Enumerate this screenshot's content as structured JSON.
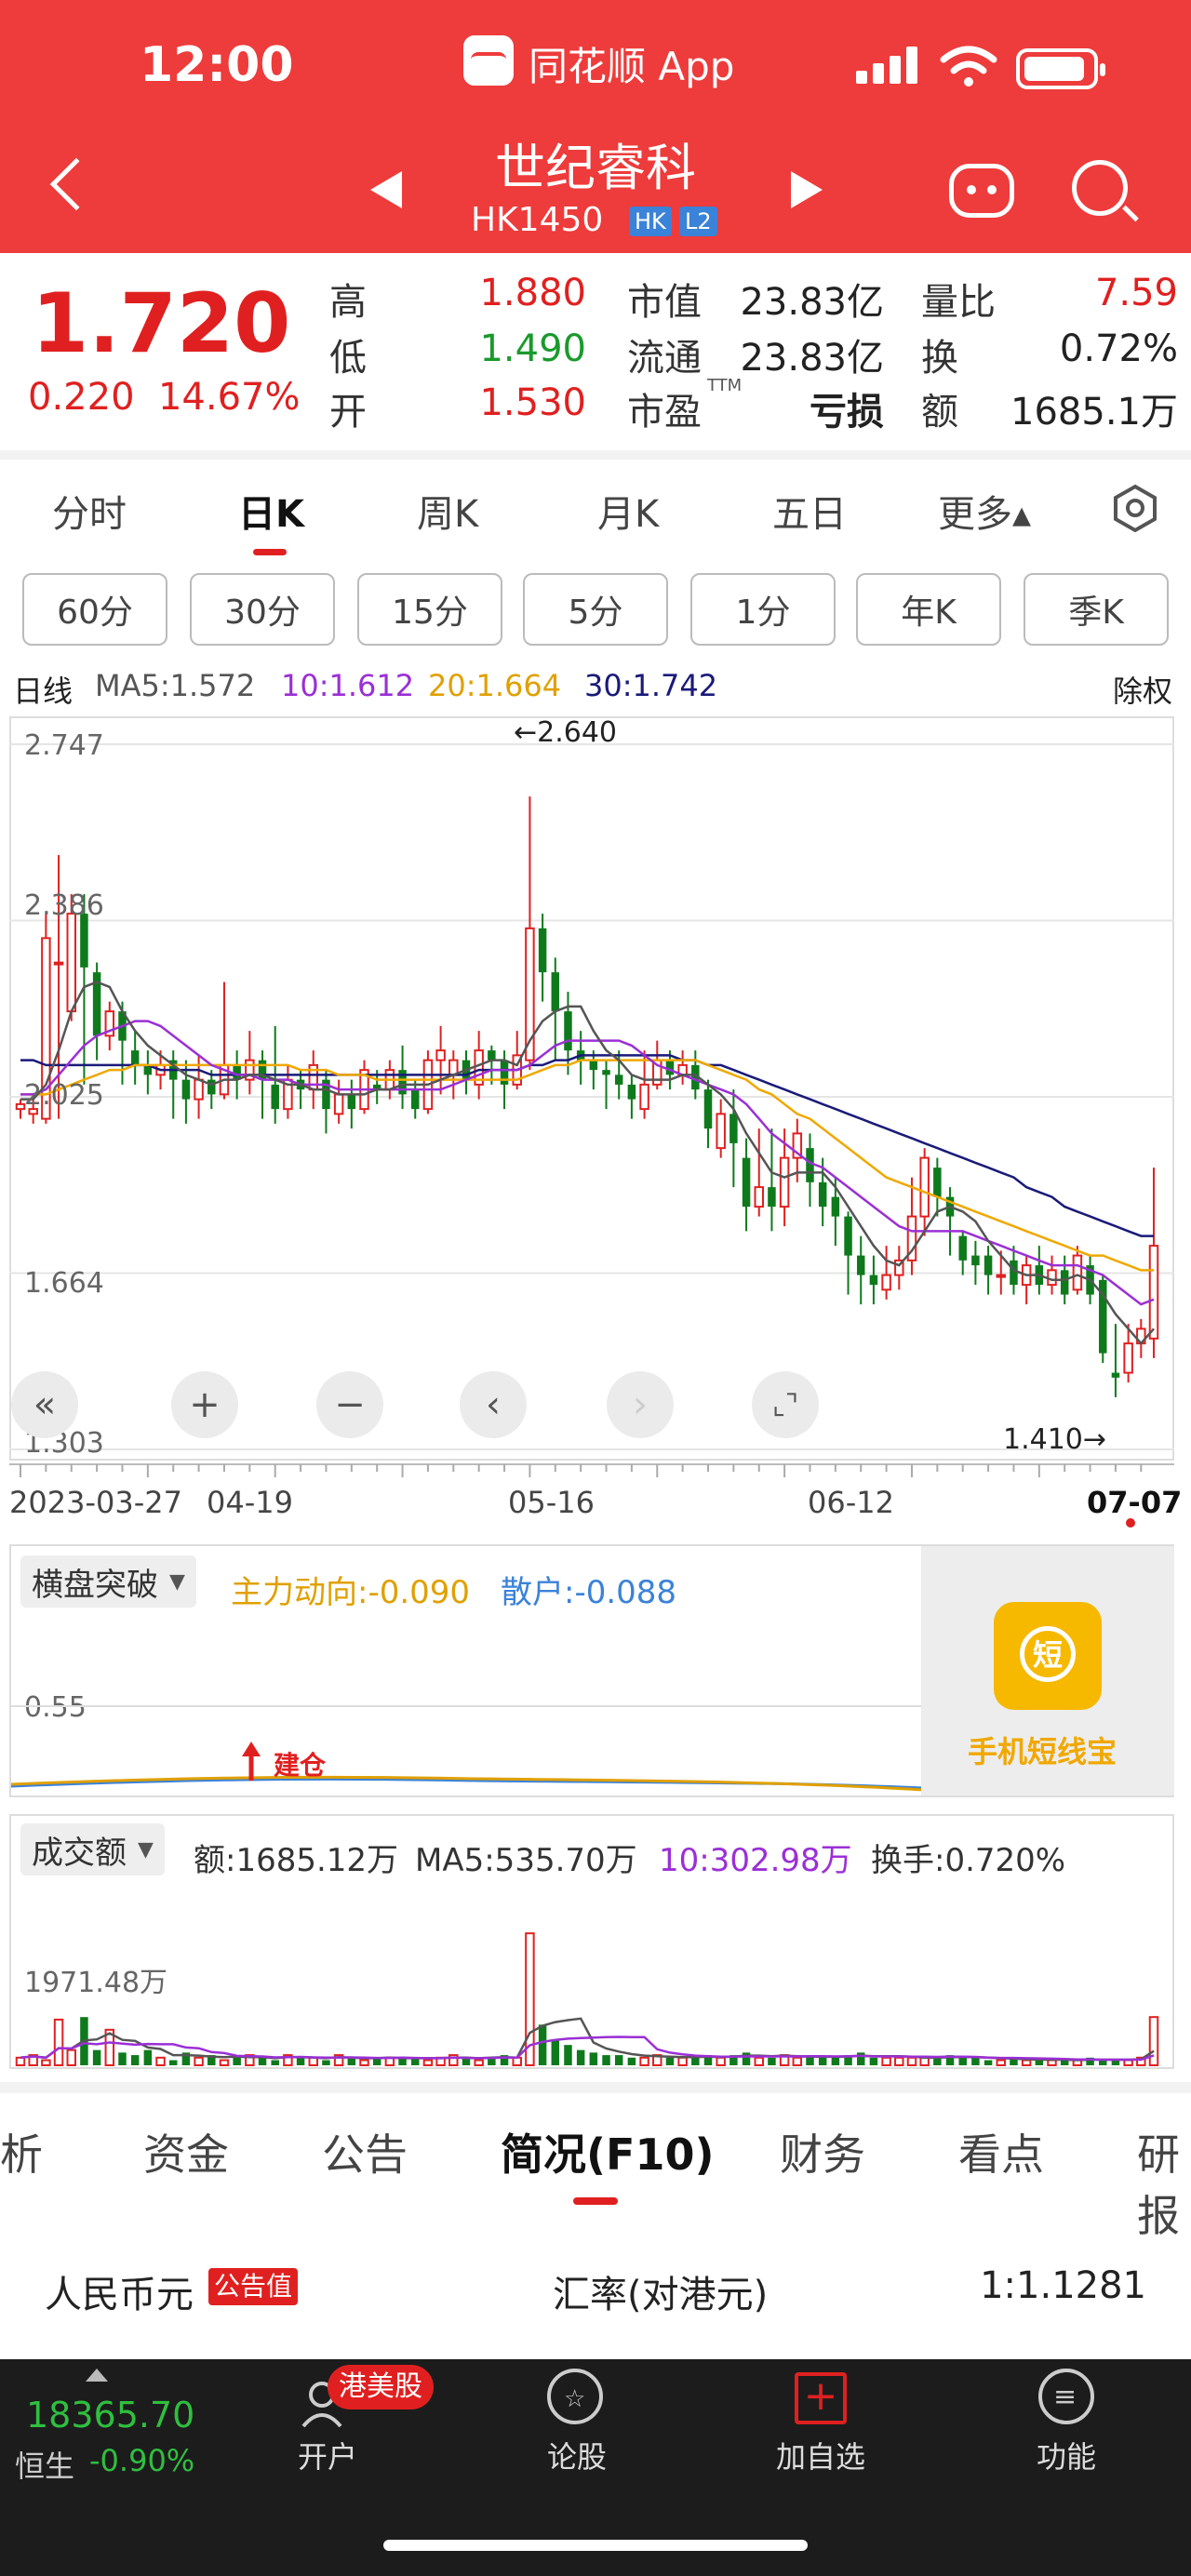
{
  "status": {
    "time": "12:00",
    "app_name": "同花顺 App"
  },
  "header": {
    "stock_name": "世纪睿科",
    "stock_code": "HK1450",
    "tags": [
      "HK",
      "L2"
    ]
  },
  "quote": {
    "price": "1.720",
    "change": "0.220",
    "change_pct": "14.67%",
    "rows": [
      {
        "l1": "高",
        "v1": "1.880",
        "c1": "red",
        "l2": "市值",
        "v2": "23.83亿",
        "l3": "量比",
        "v3": "7.59",
        "c3": "red"
      },
      {
        "l1": "低",
        "v1": "1.490",
        "c1": "green",
        "l2": "流通",
        "v2": "23.83亿",
        "l3": "换",
        "v3": "0.72%",
        "c3": "dark"
      },
      {
        "l1": "开",
        "v1": "1.530",
        "c1": "red",
        "l2": "市盈",
        "sup": "TTM",
        "v2": "亏损",
        "l3": "额",
        "v3": "1685.1万",
        "c3": "dark"
      }
    ]
  },
  "period_tabs": [
    "分时",
    "日K",
    "周K",
    "月K",
    "五日",
    "更多▴"
  ],
  "minute_buttons": [
    "60分",
    "30分",
    "15分",
    "5分",
    "1分",
    "年K",
    "季K"
  ],
  "ma_legend": {
    "label": "日线",
    "ma5": "MA5:1.572",
    "ma10": "10:1.612",
    "ma20": "20:1.664",
    "ma30": "30:1.742",
    "adjust": "除权"
  },
  "colors": {
    "up": "#e02020",
    "down": "#0e7a1c",
    "ma5": "#555555",
    "ma10": "#9b2fd6",
    "ma20": "#f0a800",
    "ma30": "#1a1a7a"
  },
  "chart_data": {
    "type": "candlestick",
    "y_ticks": [
      "2.747",
      "2.386",
      "2.025",
      "1.664",
      "1.303"
    ],
    "high_marker": "←2.640",
    "low_marker": "1.410→",
    "x_labels": [
      "2023-03-27",
      "04-19",
      "05-16",
      "06-12",
      "07-07"
    ],
    "candles": [
      [
        2.0,
        2.01,
        1.98,
        2.02
      ],
      [
        1.99,
        2.0,
        1.97,
        2.03
      ],
      [
        1.98,
        2.35,
        1.97,
        2.4
      ],
      [
        2.3,
        2.3,
        1.98,
        2.52
      ],
      [
        2.2,
        2.4,
        2.18,
        2.44
      ],
      [
        2.4,
        2.29,
        2.05,
        2.44
      ],
      [
        2.28,
        2.15,
        2.1,
        2.3
      ],
      [
        2.15,
        2.2,
        2.12,
        2.22
      ],
      [
        2.2,
        2.14,
        2.05,
        2.22
      ],
      [
        2.12,
        2.09,
        2.05,
        2.16
      ],
      [
        2.09,
        2.07,
        2.03,
        2.12
      ],
      [
        2.07,
        2.09,
        2.04,
        2.12
      ],
      [
        2.1,
        2.06,
        1.98,
        2.12
      ],
      [
        2.06,
        2.02,
        1.97,
        2.1
      ],
      [
        2.02,
        2.06,
        1.98,
        2.11
      ],
      [
        2.06,
        2.03,
        2.0,
        2.08
      ],
      [
        2.03,
        2.09,
        2.02,
        2.26
      ],
      [
        2.09,
        2.06,
        2.02,
        2.12
      ],
      [
        2.06,
        2.1,
        2.03,
        2.16
      ],
      [
        2.1,
        2.06,
        1.98,
        2.12
      ],
      [
        2.05,
        2.0,
        1.97,
        2.17
      ],
      [
        2.0,
        2.06,
        1.98,
        2.09
      ],
      [
        2.06,
        2.04,
        2.0,
        2.08
      ],
      [
        2.04,
        2.09,
        2.0,
        2.12
      ],
      [
        2.06,
        2.0,
        1.95,
        2.08
      ],
      [
        1.99,
        2.03,
        1.97,
        2.06
      ],
      [
        2.03,
        2.0,
        1.96,
        2.06
      ],
      [
        2.0,
        2.08,
        1.99,
        2.1
      ],
      [
        2.05,
        2.04,
        2.01,
        2.08
      ],
      [
        2.04,
        2.08,
        2.02,
        2.1
      ],
      [
        2.08,
        2.03,
        2.0,
        2.13
      ],
      [
        2.04,
        2.0,
        1.98,
        2.06
      ],
      [
        2.0,
        2.1,
        1.99,
        2.12
      ],
      [
        2.1,
        2.12,
        2.03,
        2.17
      ],
      [
        2.07,
        2.1,
        2.02,
        2.12
      ],
      [
        2.1,
        2.06,
        2.03,
        2.12
      ],
      [
        2.05,
        2.12,
        2.02,
        2.16
      ],
      [
        2.12,
        2.1,
        2.05,
        2.13
      ],
      [
        2.1,
        2.05,
        2.0,
        2.12
      ],
      [
        2.05,
        2.11,
        2.04,
        2.16
      ],
      [
        2.1,
        2.37,
        2.08,
        2.64
      ],
      [
        2.37,
        2.28,
        2.22,
        2.4
      ],
      [
        2.28,
        2.2,
        2.1,
        2.31
      ],
      [
        2.2,
        2.12,
        2.07,
        2.24
      ],
      [
        2.12,
        2.1,
        2.05,
        2.16
      ],
      [
        2.1,
        2.08,
        2.04,
        2.12
      ],
      [
        2.08,
        2.07,
        2.0,
        2.1
      ],
      [
        2.07,
        2.05,
        2.02,
        2.12
      ],
      [
        2.05,
        2.02,
        1.98,
        2.07
      ],
      [
        2.0,
        2.05,
        1.98,
        2.12
      ],
      [
        2.05,
        2.1,
        2.04,
        2.14
      ],
      [
        2.1,
        2.07,
        2.04,
        2.12
      ],
      [
        2.07,
        2.09,
        2.05,
        2.12
      ],
      [
        2.09,
        2.04,
        2.02,
        2.12
      ],
      [
        2.04,
        1.96,
        1.92,
        2.06
      ],
      [
        1.92,
        1.99,
        1.9,
        2.02
      ],
      [
        1.99,
        1.93,
        1.84,
        2.04
      ],
      [
        1.9,
        1.8,
        1.75,
        1.94
      ],
      [
        1.8,
        1.84,
        1.78,
        1.96
      ],
      [
        1.84,
        1.8,
        1.75,
        1.96
      ],
      [
        1.8,
        1.9,
        1.76,
        1.96
      ],
      [
        1.9,
        1.95,
        1.85,
        1.98
      ],
      [
        1.92,
        1.85,
        1.8,
        1.95
      ],
      [
        1.85,
        1.8,
        1.76,
        1.9
      ],
      [
        1.82,
        1.78,
        1.72,
        1.86
      ],
      [
        1.78,
        1.7,
        1.62,
        1.79
      ],
      [
        1.7,
        1.66,
        1.6,
        1.74
      ],
      [
        1.66,
        1.64,
        1.6,
        1.7
      ],
      [
        1.63,
        1.66,
        1.61,
        1.72
      ],
      [
        1.66,
        1.69,
        1.63,
        1.72
      ],
      [
        1.69,
        1.78,
        1.66,
        1.86
      ],
      [
        1.78,
        1.9,
        1.74,
        1.92
      ],
      [
        1.88,
        1.82,
        1.78,
        1.9
      ],
      [
        1.82,
        1.78,
        1.7,
        1.84
      ],
      [
        1.74,
        1.69,
        1.66,
        1.75
      ],
      [
        1.7,
        1.68,
        1.64,
        1.73
      ],
      [
        1.7,
        1.66,
        1.62,
        1.72
      ],
      [
        1.66,
        1.66,
        1.62,
        1.71
      ],
      [
        1.69,
        1.64,
        1.62,
        1.72
      ],
      [
        1.64,
        1.68,
        1.6,
        1.7
      ],
      [
        1.68,
        1.64,
        1.62,
        1.72
      ],
      [
        1.64,
        1.67,
        1.62,
        1.7
      ],
      [
        1.67,
        1.62,
        1.6,
        1.7
      ],
      [
        1.63,
        1.7,
        1.62,
        1.72
      ],
      [
        1.68,
        1.62,
        1.6,
        1.7
      ],
      [
        1.65,
        1.5,
        1.48,
        1.66
      ],
      [
        1.46,
        1.45,
        1.41,
        1.56
      ],
      [
        1.46,
        1.52,
        1.44,
        1.56
      ],
      [
        1.52,
        1.55,
        1.49,
        1.57
      ],
      [
        1.53,
        1.72,
        1.49,
        1.88
      ]
    ],
    "ma5": [
      2.02,
      2.02,
      2.05,
      2.12,
      2.2,
      2.25,
      2.26,
      2.25,
      2.2,
      2.16,
      2.13,
      2.11,
      2.09,
      2.07,
      2.06,
      2.05,
      2.06,
      2.06,
      2.07,
      2.07,
      2.06,
      2.05,
      2.05,
      2.04,
      2.04,
      2.03,
      2.03,
      2.03,
      2.04,
      2.04,
      2.05,
      2.05,
      2.05,
      2.06,
      2.07,
      2.08,
      2.09,
      2.1,
      2.1,
      2.09,
      2.14,
      2.18,
      2.2,
      2.21,
      2.21,
      2.16,
      2.12,
      2.1,
      2.07,
      2.06,
      2.06,
      2.06,
      2.07,
      2.07,
      2.05,
      2.03,
      2.0,
      1.95,
      1.91,
      1.87,
      1.86,
      1.87,
      1.87,
      1.87,
      1.84,
      1.8,
      1.76,
      1.72,
      1.69,
      1.68,
      1.71,
      1.75,
      1.79,
      1.8,
      1.79,
      1.77,
      1.73,
      1.7,
      1.67,
      1.66,
      1.66,
      1.65,
      1.65,
      1.66,
      1.65,
      1.62,
      1.58,
      1.55,
      1.52,
      1.55
    ],
    "ma10": [
      2.03,
      2.03,
      2.04,
      2.07,
      2.1,
      2.13,
      2.15,
      2.16,
      2.17,
      2.18,
      2.18,
      2.17,
      2.15,
      2.13,
      2.11,
      2.09,
      2.08,
      2.07,
      2.07,
      2.06,
      2.06,
      2.06,
      2.05,
      2.05,
      2.05,
      2.04,
      2.04,
      2.04,
      2.04,
      2.04,
      2.04,
      2.04,
      2.04,
      2.04,
      2.05,
      2.06,
      2.07,
      2.08,
      2.08,
      2.08,
      2.09,
      2.11,
      2.13,
      2.14,
      2.14,
      2.14,
      2.14,
      2.14,
      2.13,
      2.11,
      2.09,
      2.08,
      2.07,
      2.06,
      2.05,
      2.04,
      2.03,
      2.01,
      1.98,
      1.95,
      1.93,
      1.91,
      1.89,
      1.88,
      1.86,
      1.84,
      1.82,
      1.8,
      1.78,
      1.76,
      1.75,
      1.75,
      1.75,
      1.75,
      1.75,
      1.74,
      1.73,
      1.72,
      1.71,
      1.7,
      1.69,
      1.68,
      1.68,
      1.68,
      1.67,
      1.66,
      1.64,
      1.62,
      1.6,
      1.61
    ],
    "ma20": [
      2.03,
      2.03,
      2.03,
      2.04,
      2.05,
      2.06,
      2.07,
      2.08,
      2.08,
      2.09,
      2.09,
      2.09,
      2.09,
      2.09,
      2.09,
      2.09,
      2.09,
      2.09,
      2.09,
      2.09,
      2.09,
      2.09,
      2.08,
      2.08,
      2.08,
      2.07,
      2.07,
      2.07,
      2.06,
      2.06,
      2.06,
      2.06,
      2.06,
      2.06,
      2.06,
      2.06,
      2.06,
      2.06,
      2.06,
      2.06,
      2.07,
      2.08,
      2.09,
      2.09,
      2.1,
      2.1,
      2.1,
      2.1,
      2.1,
      2.1,
      2.1,
      2.1,
      2.1,
      2.1,
      2.09,
      2.08,
      2.07,
      2.06,
      2.04,
      2.03,
      2.01,
      1.99,
      1.98,
      1.96,
      1.94,
      1.92,
      1.9,
      1.88,
      1.86,
      1.85,
      1.84,
      1.83,
      1.82,
      1.81,
      1.8,
      1.79,
      1.78,
      1.77,
      1.76,
      1.75,
      1.74,
      1.73,
      1.72,
      1.71,
      1.7,
      1.7,
      1.69,
      1.68,
      1.67,
      1.67
    ],
    "ma30": [
      2.1,
      2.1,
      2.09,
      2.09,
      2.09,
      2.09,
      2.09,
      2.09,
      2.09,
      2.09,
      2.09,
      2.08,
      2.08,
      2.08,
      2.08,
      2.07,
      2.07,
      2.07,
      2.07,
      2.07,
      2.07,
      2.07,
      2.07,
      2.07,
      2.07,
      2.07,
      2.07,
      2.07,
      2.07,
      2.07,
      2.07,
      2.07,
      2.07,
      2.07,
      2.07,
      2.07,
      2.08,
      2.08,
      2.08,
      2.08,
      2.09,
      2.09,
      2.1,
      2.1,
      2.11,
      2.11,
      2.11,
      2.11,
      2.11,
      2.11,
      2.11,
      2.11,
      2.1,
      2.1,
      2.09,
      2.09,
      2.08,
      2.07,
      2.06,
      2.05,
      2.04,
      2.03,
      2.02,
      2.01,
      2.0,
      1.99,
      1.98,
      1.97,
      1.96,
      1.95,
      1.94,
      1.93,
      1.92,
      1.91,
      1.9,
      1.89,
      1.88,
      1.87,
      1.86,
      1.84,
      1.83,
      1.82,
      1.8,
      1.79,
      1.78,
      1.77,
      1.76,
      1.75,
      1.74,
      1.74
    ]
  },
  "indicator": {
    "selector": "横盘突破",
    "main_force": "主力动向:-0.090",
    "retail": "散户:-0.088",
    "tick": "0.55",
    "build_label": "建仓",
    "promo": "手机短线宝",
    "promo_icon": "短"
  },
  "volume": {
    "selector": "成交额",
    "amount": "额:1685.12万",
    "ma5": "MA5:535.70万",
    "ma10": "10:302.98万",
    "turnover": "换手:0.720%",
    "tick": "1971.48万",
    "bars": [
      3,
      4,
      2,
      18,
      6,
      19,
      6,
      14,
      5,
      4,
      6,
      3,
      2,
      5,
      3,
      4,
      2,
      3,
      4,
      3,
      2,
      4,
      3,
      3,
      2,
      4,
      3,
      2,
      3,
      3,
      3,
      3,
      2,
      3,
      4,
      3,
      2,
      3,
      4,
      3,
      52,
      16,
      10,
      8,
      6,
      5,
      4,
      4,
      3,
      3,
      4,
      3,
      3,
      3,
      4,
      3,
      4,
      5,
      3,
      3,
      4,
      3,
      4,
      3,
      3,
      4,
      5,
      3,
      3,
      3,
      3,
      3,
      3,
      4,
      3,
      3,
      2,
      2,
      3,
      2,
      2,
      2,
      2,
      2,
      3,
      2,
      2,
      2,
      3,
      19
    ]
  },
  "f10_tabs": [
    "分析",
    "资金",
    "公告",
    "简况(F10)",
    "财务",
    "看点",
    "研报"
  ],
  "currency_row": {
    "currency": "人民币元",
    "badge": "公告值",
    "rate_label": "汇率(对港元)",
    "rate": "1:1.1281"
  },
  "bottom_nav": {
    "index_value": "18365.70",
    "index_name": "恒生",
    "index_change": "-0.90%",
    "badge": "港美股",
    "items": [
      "开户",
      "论股",
      "加自选",
      "功能"
    ]
  }
}
